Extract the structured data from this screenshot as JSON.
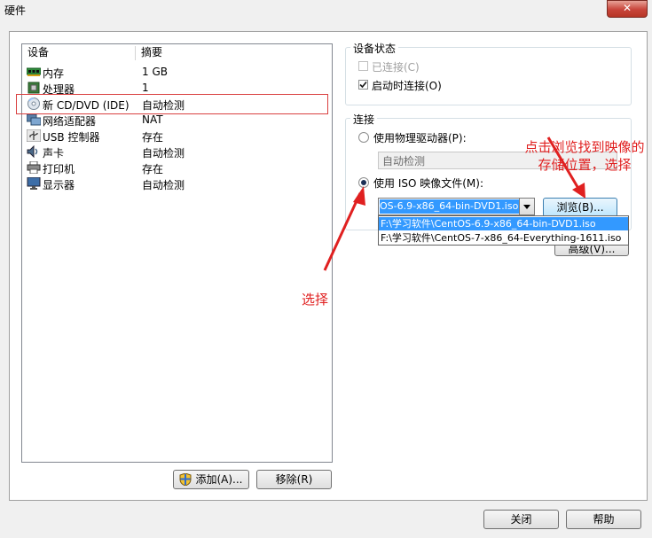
{
  "window": {
    "title": "硬件",
    "close_label": "✕"
  },
  "device_list": {
    "headers": {
      "device": "设备",
      "summary": "摘要"
    },
    "rows": [
      {
        "name": "内存",
        "summary": "1 GB",
        "icon": "memory-icon"
      },
      {
        "name": "处理器",
        "summary": "1",
        "icon": "processor-icon"
      },
      {
        "name": "新 CD/DVD (IDE)",
        "summary": "自动检测",
        "icon": "cd-dvd-icon"
      },
      {
        "name": "网络适配器",
        "summary": "NAT",
        "icon": "network-adapter-icon"
      },
      {
        "name": "USB 控制器",
        "summary": "存在",
        "icon": "usb-icon"
      },
      {
        "name": "声卡",
        "summary": "自动检测",
        "icon": "sound-card-icon"
      },
      {
        "name": "打印机",
        "summary": "存在",
        "icon": "printer-icon"
      },
      {
        "name": "显示器",
        "summary": "自动检测",
        "icon": "monitor-icon"
      }
    ]
  },
  "buttons": {
    "add": "添加(A)...",
    "remove": "移除(R)",
    "close": "关闭",
    "help": "帮助"
  },
  "device_status": {
    "title": "设备状态",
    "connected": "已连接(C)",
    "connect_on_start": "启动时连接(O)"
  },
  "connection": {
    "title": "连接",
    "physical_drive": "使用物理驱动器(P):",
    "physical_drive_value": "自动检测",
    "iso_image": "使用 ISO 映像文件(M):",
    "iso_combo_value": "OS-6.9-x86_64-bin-DVD1.iso",
    "iso_options": [
      "F:\\学习软件\\CentOS-6.9-x86_64-bin-DVD1.iso",
      "F:\\学习软件\\CentOS-7-x86_64-Everything-1611.iso"
    ],
    "browse": "浏览(B)...",
    "advanced": "高级(V)..."
  },
  "annotations": {
    "select": "选择",
    "browse_hint": "点击浏览找到映像的存储位置，选择",
    "color": "#e02020"
  }
}
